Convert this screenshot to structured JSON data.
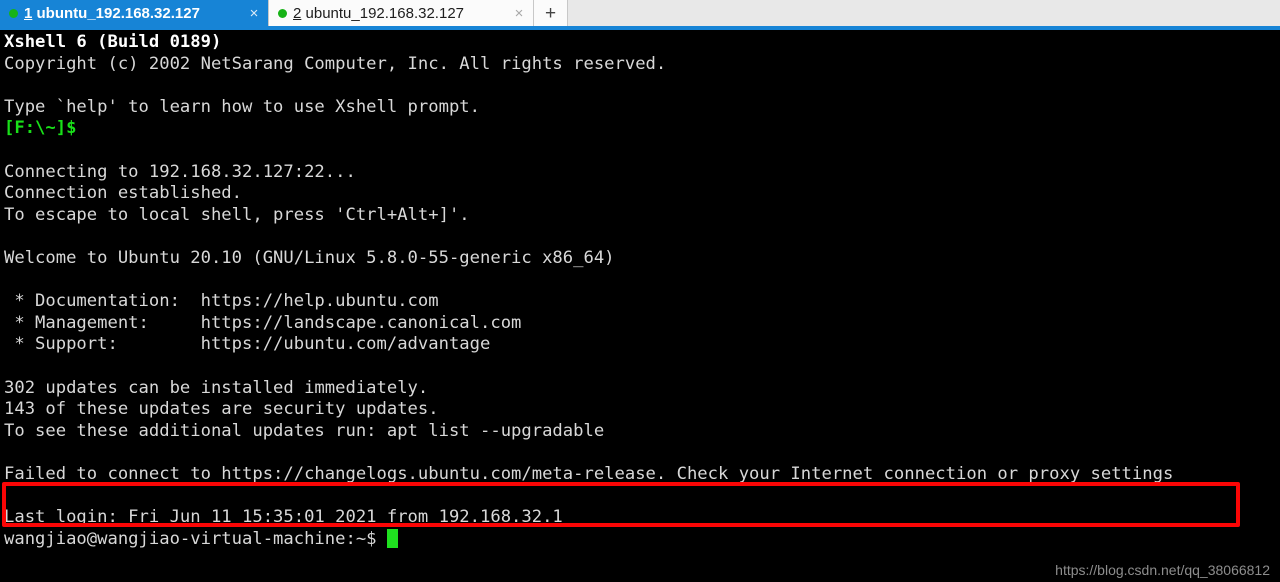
{
  "window": {
    "app": "Xshell 6",
    "accent_blue": "#1784d6",
    "terminal_bg": "#000000",
    "terminal_fg": "#d6d6d6",
    "annotation_color": "#fb0505",
    "cursor_color": "#1fe01f"
  },
  "tabbar": {
    "tabs": [
      {
        "index": "1",
        "title": "ubuntu_192.168.32.127",
        "active": true,
        "status_dot": "connected-dot",
        "close_label": "×"
      },
      {
        "index": "2",
        "title": "ubuntu_192.168.32.127",
        "active": false,
        "status_dot": "connected-dot",
        "close_label": "×"
      }
    ],
    "new_tab_label": "+"
  },
  "terminal": {
    "lines": [
      {
        "text": "Xshell 6 (Build 0189)",
        "style": "b-white"
      },
      {
        "text": "Copyright (c) 2002 NetSarang Computer, Inc. All rights reserved.",
        "style": "plain"
      },
      {
        "text": "",
        "style": "plain"
      },
      {
        "text": "Type `help' to learn how to use Xshell prompt.",
        "style": "plain"
      },
      {
        "text": "[F:\\~]$",
        "style": "g-bold"
      },
      {
        "text": "",
        "style": "plain"
      },
      {
        "text": "Connecting to 192.168.32.127:22...",
        "style": "plain"
      },
      {
        "text": "Connection established.",
        "style": "plain"
      },
      {
        "text": "To escape to local shell, press 'Ctrl+Alt+]'.",
        "style": "plain"
      },
      {
        "text": "",
        "style": "plain"
      },
      {
        "text": "Welcome to Ubuntu 20.10 (GNU/Linux 5.8.0-55-generic x86_64)",
        "style": "plain"
      },
      {
        "text": "",
        "style": "plain"
      },
      {
        "text": " * Documentation:  https://help.ubuntu.com",
        "style": "plain"
      },
      {
        "text": " * Management:     https://landscape.canonical.com",
        "style": "plain"
      },
      {
        "text": " * Support:        https://ubuntu.com/advantage",
        "style": "plain"
      },
      {
        "text": "",
        "style": "plain"
      },
      {
        "text": "302 updates can be installed immediately.",
        "style": "plain"
      },
      {
        "text": "143 of these updates are security updates.",
        "style": "plain"
      },
      {
        "text": "To see these additional updates run: apt list --upgradable",
        "style": "plain"
      },
      {
        "text": "",
        "style": "plain"
      },
      {
        "text": "Failed to connect to https://changelogs.ubuntu.com/meta-release. Check your Internet connection or proxy settings",
        "style": "plain"
      },
      {
        "text": "",
        "style": "plain"
      },
      {
        "text": "Last login: Fri Jun 11 15:35:01 2021 from 192.168.32.1",
        "style": "plain"
      }
    ],
    "prompt": "wangjiao@wangjiao-virtual-machine:~$ "
  },
  "annotation": {
    "highlighted_text": "Failed to connect to https://changelogs.ubuntu.com/meta-release. Check your Internet connection or proxy settings"
  },
  "watermark": {
    "text": "https://blog.csdn.net/qq_38066812"
  }
}
